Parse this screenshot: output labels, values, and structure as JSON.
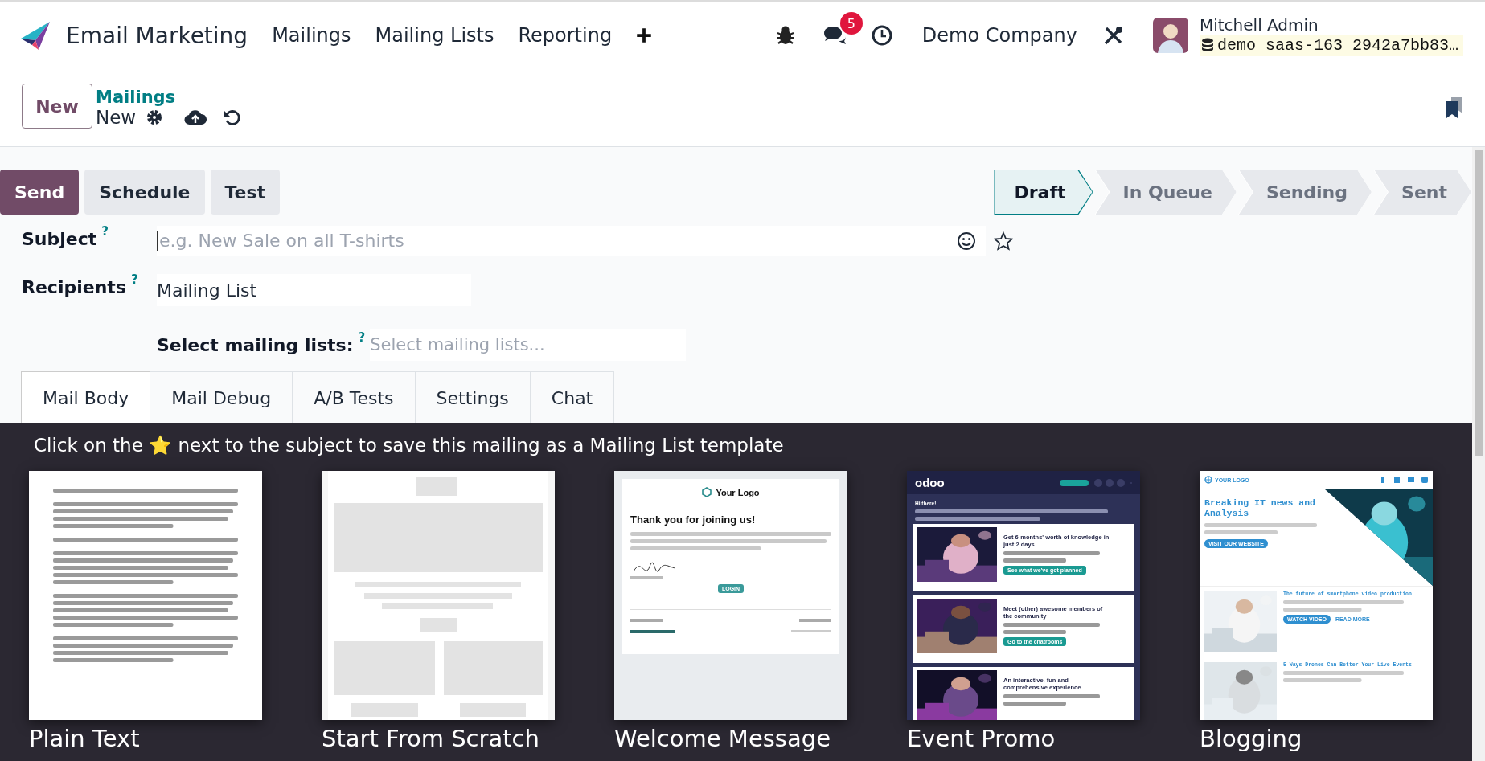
{
  "navbar": {
    "app_name": "Email Marketing",
    "menu": [
      {
        "label": "Mailings"
      },
      {
        "label": "Mailing Lists"
      },
      {
        "label": "Reporting"
      }
    ],
    "messages_badge": "5",
    "company": "Demo Company",
    "user": "Mitchell Admin",
    "database": "demo_saas-163_2942a7bb83…"
  },
  "control_panel": {
    "new_button": "New",
    "breadcrumb": "Mailings",
    "record_name": "New"
  },
  "actions": [
    {
      "label": "Send",
      "kind": "primary"
    },
    {
      "label": "Schedule",
      "kind": "secondary"
    },
    {
      "label": "Test",
      "kind": "secondary"
    }
  ],
  "status_steps": [
    {
      "label": "Draft",
      "selected": true
    },
    {
      "label": "In Queue",
      "selected": false
    },
    {
      "label": "Sending",
      "selected": false
    },
    {
      "label": "Sent",
      "selected": false
    }
  ],
  "fields": {
    "subject": {
      "label": "Subject",
      "help": "?",
      "placeholder": "e.g. New Sale on all T-shirts"
    },
    "recipients": {
      "label": "Recipients",
      "help": "?",
      "value": "Mailing List"
    },
    "mailing_lists": {
      "label": "Select mailing lists:",
      "help": "?",
      "placeholder": "Select mailing lists..."
    }
  },
  "tabs": [
    {
      "label": "Mail Body",
      "selected": true
    },
    {
      "label": "Mail Debug",
      "selected": false
    },
    {
      "label": "A/B Tests",
      "selected": false
    },
    {
      "label": "Settings",
      "selected": false
    },
    {
      "label": "Chat",
      "selected": false
    }
  ],
  "template_hint": "Click on the ⭐ next to the subject to save this mailing as a Mailing List template",
  "templates": [
    {
      "name": "Plain Text",
      "kind": "plain"
    },
    {
      "name": "Start From Scratch",
      "kind": "scratch"
    },
    {
      "name": "Welcome Message",
      "kind": "welcome",
      "logo": "Your Logo",
      "title": "Thank you for joining us!",
      "button": "LOGIN"
    },
    {
      "name": "Event Promo",
      "kind": "event",
      "brand": "odoo",
      "greeting": "Hi there!",
      "items": [
        {
          "title": "Get 6-months' worth of knowledge in just 2 days",
          "button": "See what we've got planned"
        },
        {
          "title": "Meet (other) awesome members of the community",
          "button": "Go to the chatrooms"
        },
        {
          "title": "An interactive, fun and comprehensive experience"
        }
      ]
    },
    {
      "name": "Blogging",
      "kind": "blog",
      "logo": "YOUR LOGO",
      "title": "Breaking IT news and Analysis",
      "button": "VISIT OUR WEBSITE",
      "posts": [
        {
          "title": "The future of smartphone video production",
          "buttons": [
            "WATCH VIDEO",
            "READ MORE"
          ]
        },
        {
          "title": "5 Ways Drones Can Better Your Live Events"
        }
      ]
    }
  ]
}
